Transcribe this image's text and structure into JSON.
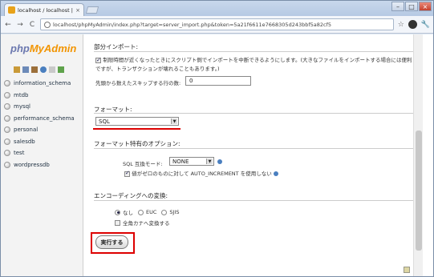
{
  "browser": {
    "tab_title": "localhost / localhost | php",
    "tab_close": "×",
    "url": "localhost/phpMyAdmin/index.php?target=server_import.php&token=5a21f6611e7668305d243bbf5a82cf5",
    "controls": {
      "minimize": "–",
      "maximize": "□",
      "close": "×"
    },
    "back": "←",
    "forward": "→",
    "reload": "C",
    "home": "⌂",
    "star": "☆",
    "wrench": "🔧"
  },
  "sidebar": {
    "logo_php": "php",
    "logo_my": "My",
    "logo_admin": "Admin",
    "databases": [
      "information_schema",
      "mtdb",
      "mysql",
      "performance_schema",
      "personal",
      "salesdb",
      "test",
      "wordpressdb"
    ]
  },
  "partial_import": {
    "heading": "部分インポート:",
    "allow_interrupt_text": "制限時間が近くなったときにスクリプト側でインポートを中断できるようにします。(大きなファイルをインポートする場合には便利ですが、トランザクションが壊れることもあります。)",
    "skip_label": "先頭から数えたスキップする行の数:",
    "skip_value": "0"
  },
  "format": {
    "heading": "フォーマット:",
    "selected": "SQL",
    "arrow": "▼"
  },
  "format_options": {
    "heading": "フォーマット特有のオプション:",
    "compat_label": "SQL 互換モード:",
    "compat_value": "NONE",
    "auto_inc_text": "値がゼロのものに対して AUTO_INCREMENT を使用しない"
  },
  "encoding": {
    "heading": "エンコーディングへの変換:",
    "options": [
      "なし",
      "EUC",
      "SJIS"
    ],
    "selected": "なし",
    "fullwidth_label": "全角カナへ変換する"
  },
  "go_button": "実行する",
  "colors": {
    "accent_red": "#dd0000",
    "logo_blue": "#6c78af",
    "logo_orange": "#f29400"
  }
}
